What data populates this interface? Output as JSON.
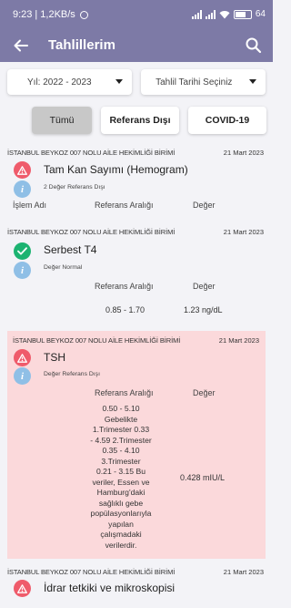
{
  "status_bar": {
    "time": "9:23",
    "speed": "1,2KB/s",
    "battery": "64"
  },
  "app_bar": {
    "title": "Tahlillerim"
  },
  "filters": {
    "year": "Yıl: 2022 - 2023",
    "date": "Tahlil Tarihi Seçiniz"
  },
  "tabs": [
    {
      "label": "Tümü",
      "active": true
    },
    {
      "label": "Referans Dışı",
      "active": false
    },
    {
      "label": "COVID-19",
      "active": false
    }
  ],
  "columns": {
    "name": "İşlem Adı",
    "ref": "Referans Aralığı",
    "value": "Değer"
  },
  "results": [
    {
      "institution": "İSTANBUL BEYKOZ 007 NOLU AİLE HEKİMLİĞİ BİRİMİ",
      "date": "21 Mart 2023",
      "name": "Tam Kan Sayımı (Hemogram)",
      "status": "warning",
      "note": "2 Değer Referans Dışı"
    },
    {
      "institution": "İSTANBUL BEYKOZ 007 NOLU AİLE HEKİMLİĞİ BİRİMİ",
      "date": "21 Mart 2023",
      "name": "Serbest T4",
      "status": "normal",
      "note": "Değer Normal",
      "ref": "0.85 - 1.70",
      "value": "1.23 ng/dL"
    },
    {
      "institution": "İSTANBUL BEYKOZ 007 NOLU AİLE HEKİMLİĞİ BİRİMİ",
      "date": "21 Mart 2023",
      "name": "TSH",
      "status": "warning",
      "note": "Değer Referans Dışı",
      "ref": "0.50 - 5.10\nGebelikte\n1.Trimester   0.33\n- 4.59 2.Trimester\n0.35 - 4.10\n3.Trimester\n0.21 - 3.15  Bu\nveriler, Essen ve\nHamburg'daki\nsağlıklı gebe\npopülasyonlarıyla\nyapılan\nçalışmadaki\nverilerdir.",
      "value": "0.428 mIU/L"
    },
    {
      "institution": "İSTANBUL BEYKOZ 007 NOLU AİLE HEKİMLİĞİ BİRİMİ",
      "date": "21 Mart 2023",
      "name": "İdrar tetkiki ve mikroskopisi",
      "status": "warning"
    }
  ],
  "colors": {
    "header": "#7d7aa6",
    "warning_icon": "#ef5b6b",
    "normal_icon": "#1cb371",
    "info_icon": "#8fbfe6",
    "alert_card_bg": "#fbd9db"
  },
  "icons": {
    "back": "arrow-left-icon",
    "search": "search-icon",
    "warning": "warning-triangle-icon",
    "normal": "check-icon",
    "info": "info-icon"
  }
}
